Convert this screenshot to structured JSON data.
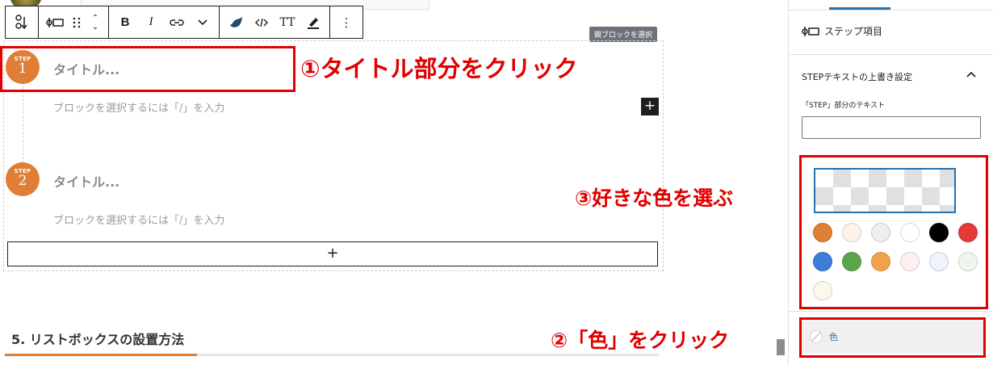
{
  "toolbar": {
    "transform_icon": "step-transform-icon",
    "block_icon": "step-block-icon",
    "bold": "B",
    "italic": "I",
    "text_size": "TT",
    "more": "⋮"
  },
  "parent_block_button": "親ブロックを選択",
  "steps": [
    {
      "step_label": "STEP",
      "number": "1",
      "title_placeholder": "タイトル...",
      "content_placeholder": "ブロックを選択するには「/」を入力"
    },
    {
      "step_label": "STEP",
      "number": "2",
      "title_placeholder": "タイトル...",
      "content_placeholder": "ブロックを選択するには「/」を入力"
    }
  ],
  "add_inner_block": "+",
  "add_block": "+",
  "heading": "5. リストボックスの設置方法",
  "sidebar": {
    "block_name": "ステップ項目",
    "panel_title": "STEPテキストの上書き設定",
    "field_label": "「STEP」部分のテキスト",
    "field_value": "",
    "palette": [
      "#e07e35",
      "#fdf3e9",
      "#eeeeee",
      "#ffffff",
      "#000000",
      "#e53a3a",
      "#3b7dd8",
      "#5aa547",
      "#f0a24a",
      "#fdf0ef",
      "#eef4fb",
      "#eef7ee",
      "#fbf8ec"
    ],
    "color_button": "色"
  },
  "annotations": {
    "step1": "①タイトル部分をクリック",
    "step2": "②「色」をクリック",
    "step3": "③好きな色を選ぶ"
  },
  "colors": {
    "annotation_red": "#e00000",
    "step_orange": "#e07e35",
    "accent_blue": "#2271b1"
  }
}
